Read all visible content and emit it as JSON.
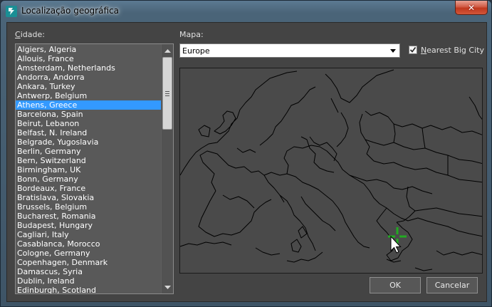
{
  "window": {
    "title": "Localização geográfica",
    "close_glyph": "✕"
  },
  "labels": {
    "city": "Cidade:",
    "map": "Mapa:",
    "nearest": "Nearest Big City"
  },
  "cities": [
    "Algiers, Algeria",
    "Allouis, France",
    "Amsterdam, Netherlands",
    "Andorra, Andorra",
    "Ankara, Turkey",
    "Antwerp, Belgium",
    "Athens, Greece",
    "Barcelona, Spain",
    "Beirut, Lebanon",
    "Belfast, N. Ireland",
    "Belgrade, Yugoslavia",
    "Berlin, Germany",
    "Bern, Switzerland",
    "Birmingham, UK",
    "Bonn, Germany",
    "Bordeaux, France",
    "Bratislava, Slovakia",
    "Brussels, Belgium",
    "Bucharest, Romania",
    "Budapest, Hungary",
    "Cagliari, Italy",
    "Casablanca, Morocco",
    "Cologne, Germany",
    "Copenhagen, Denmark",
    "Damascus, Syria",
    "Dublin, Ireland",
    "Edinburgh, Scotland"
  ],
  "selected_city": "Athens, Greece",
  "map_select": {
    "value": "Europe"
  },
  "nearest_checked": true,
  "buttons": {
    "ok": "OK",
    "cancel": "Cancelar"
  },
  "colors": {
    "selection": "#3399ff",
    "marker": "#22aa22",
    "map_border_lines": "#000000"
  },
  "icons": {
    "app": "3dsmax-app-icon",
    "close": "close-icon",
    "dropdown": "chevron-down-icon",
    "scroll_up": "scroll-up-arrow-icon",
    "scroll_down": "scroll-down-arrow-icon",
    "marker": "crosshair-marker-icon",
    "cursor": "mouse-pointer-icon"
  }
}
